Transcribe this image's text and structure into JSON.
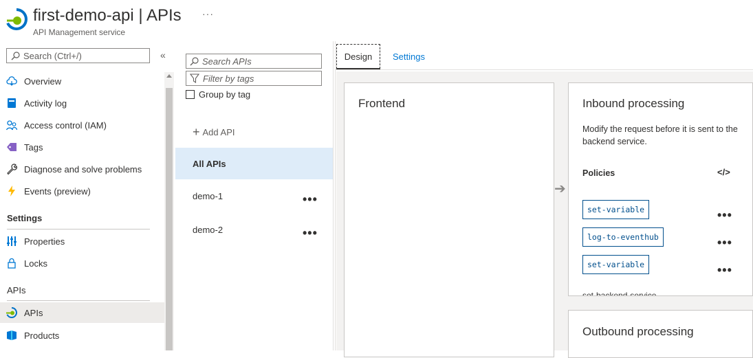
{
  "header": {
    "title": "first-demo-api | APIs",
    "subtitle": "API Management service",
    "more": "···"
  },
  "nav": {
    "search_placeholder": "Search (Ctrl+/)",
    "collapse": "«",
    "items": [
      {
        "label": "Overview",
        "icon": "cloud-icon"
      },
      {
        "label": "Activity log",
        "icon": "activity-log-icon"
      },
      {
        "label": "Access control (IAM)",
        "icon": "people-icon"
      },
      {
        "label": "Tags",
        "icon": "tag-icon"
      },
      {
        "label": "Diagnose and solve problems",
        "icon": "wrench-icon"
      },
      {
        "label": "Events (preview)",
        "icon": "lightning-icon"
      }
    ],
    "settings_heading": "Settings",
    "settings_items": [
      {
        "label": "Properties",
        "icon": "properties-icon"
      },
      {
        "label": "Locks",
        "icon": "lock-icon"
      }
    ],
    "apis_heading": "APIs",
    "apis_items": [
      {
        "label": "APIs",
        "icon": "api-icon",
        "selected": true
      },
      {
        "label": "Products",
        "icon": "products-icon"
      }
    ]
  },
  "api_list": {
    "search_placeholder": "Search APIs",
    "filter_placeholder": "Filter by tags",
    "group_by_label": "Group by tag",
    "add_api_label": "Add API",
    "all_apis_label": "All APIs",
    "apis": [
      {
        "name": "demo-1",
        "more": "•••"
      },
      {
        "name": "demo-2",
        "more": "•••"
      }
    ]
  },
  "tabs": {
    "design": "Design",
    "settings": "Settings"
  },
  "design": {
    "frontend_title": "Frontend",
    "arrow": "➔",
    "inbound": {
      "title": "Inbound processing",
      "description": "Modify the request before it is sent to the backend service.",
      "policies_label": "Policies",
      "code_icon": "</>",
      "policies": [
        {
          "name": "set-variable",
          "more": "•••"
        },
        {
          "name": "log-to-eventhub",
          "more": "•••"
        },
        {
          "name": "set-variable",
          "more": "•••"
        }
      ],
      "cutoff_text": "set-backend-service"
    },
    "outbound_title": "Outbound processing"
  },
  "colors": {
    "accent": "#0078d4",
    "selected_bg": "#deecf9",
    "policy_border": "#004e8c"
  }
}
